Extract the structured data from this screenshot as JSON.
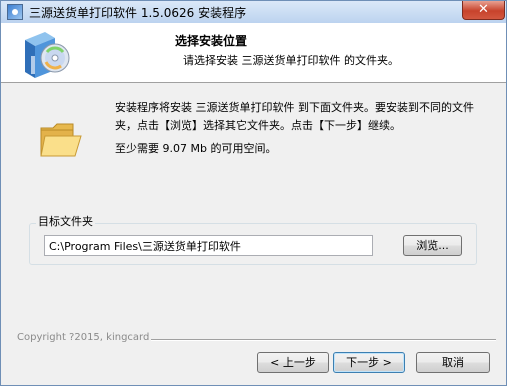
{
  "window": {
    "title": "三源送货单打印软件 1.5.0626 安装程序",
    "close_glyph": "✕"
  },
  "header": {
    "title": "选择安装位置",
    "subtitle": "请选择安装 三源送货单打印软件 的文件夹。"
  },
  "body": {
    "description": "安装程序将安装 三源送货单打印软件 到下面文件夹。要安装到不同的文件夹，点击【浏览】选择其它文件夹。点击【下一步】继续。",
    "space_required": "至少需要 9.07 Mb 的可用空间。"
  },
  "destination": {
    "group_label": "目标文件夹",
    "path": "C:\\Program Files\\三源送货单打印软件",
    "browse_label": "浏览..."
  },
  "footer": {
    "copyright": "Copyright ?2015, kingcard",
    "back_label": "< 上一步",
    "next_label": "下一步 >",
    "cancel_label": "取消"
  },
  "icons": {
    "app": "installer-app-icon",
    "logo": "install-box-cd-icon",
    "folder": "open-folder-icon"
  },
  "colors": {
    "title_bar": "#bcd3ef",
    "close_button": "#c7432c",
    "dialog_bg": "#f0f0f0",
    "header_bg": "#ffffff"
  }
}
